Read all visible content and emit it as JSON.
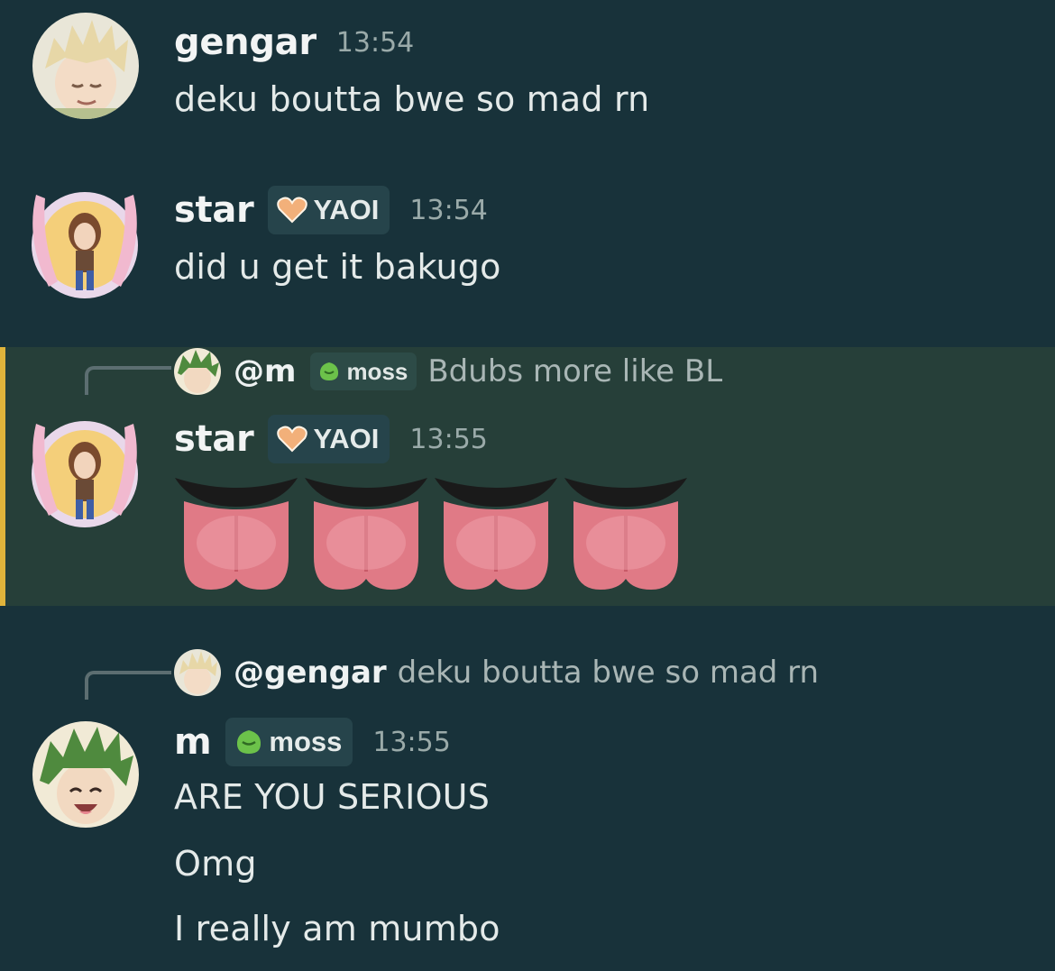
{
  "colors": {
    "background": "#18323a",
    "highlight": "#263f39",
    "highlight_bar": "#e0b43b",
    "tag_bg": "#26444b",
    "timestamp": "#9aaaa9"
  },
  "messages": [
    {
      "username": "gengar",
      "time": "13:54",
      "text": "deku boutta bwe so mad rn",
      "avatar_icon": "blonde-spiky-anime-avatar-icon"
    },
    {
      "username": "star",
      "tag": {
        "label": "YAOI",
        "icon": "heart-icon"
      },
      "time": "13:54",
      "text": "did u get it bakugo",
      "avatar_icon": "mii-bunny-frame-avatar-icon"
    },
    {
      "reply": {
        "user": "@m",
        "tag": {
          "label": "moss",
          "icon": "leaf-icon"
        },
        "text": "Bdubs more like BL"
      },
      "username": "star",
      "tag": {
        "label": "YAOI",
        "icon": "heart-icon"
      },
      "time": "13:55",
      "emoji": [
        "tongue-emoji",
        "tongue-emoji",
        "tongue-emoji",
        "tongue-emoji"
      ],
      "highlighted": true
    },
    {
      "reply": {
        "user": "@gengar",
        "text": "deku boutta bwe so mad rn"
      },
      "username": "m",
      "tag": {
        "label": "moss",
        "icon": "leaf-icon"
      },
      "time": "13:55",
      "lines": [
        "ARE YOU SERIOUS",
        "Omg",
        "I really am mumbo"
      ],
      "avatar_icon": "green-hair-anime-avatar-icon"
    }
  ]
}
